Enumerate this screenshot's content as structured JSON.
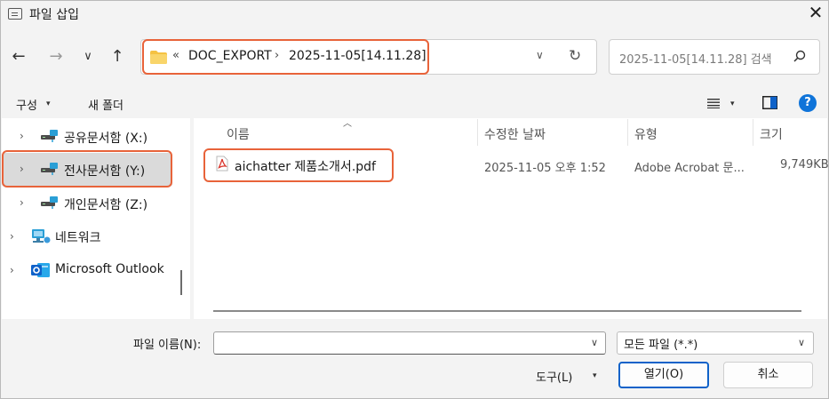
{
  "window": {
    "title": "파일 삽입"
  },
  "nav": {
    "back": "←",
    "forward": "→",
    "recent": "∨",
    "up": "↑"
  },
  "address": {
    "prefix": "«",
    "crumbs": [
      "DOC_EXPORT",
      "2025-11-05[14.11.28]"
    ],
    "separator": "›"
  },
  "search": {
    "placeholder": "2025-11-05[14.11.28] 검색"
  },
  "toolbar": {
    "organize": "구성",
    "new_folder": "새 폴더",
    "caret": "▾"
  },
  "tree": [
    {
      "label": "공유문서함 (X:)",
      "icon": "network-drive-icon"
    },
    {
      "label": "전사문서함 (Y:)",
      "icon": "network-drive-icon",
      "selected": true
    },
    {
      "label": "개인문서함 (Z:)",
      "icon": "network-drive-icon"
    },
    {
      "label": "네트워크",
      "icon": "network-icon"
    },
    {
      "label": "Microsoft Outlook",
      "icon": "outlook-icon"
    }
  ],
  "columns": {
    "name": "이름",
    "modified": "수정한 날짜",
    "type": "유형",
    "size": "크기"
  },
  "files": [
    {
      "name": "aichatter 제품소개서.pdf",
      "modified": "2025-11-05 오후 1:52",
      "type": "Adobe Acrobat 문...",
      "size": "9,749KB",
      "icon": "pdf-icon"
    }
  ],
  "footer": {
    "filename_label": "파일 이름(N):",
    "filename_value": "",
    "filter": "모든 파일 (*.*)",
    "tools": "도구(L)",
    "open": "열기(O)",
    "cancel": "취소"
  },
  "colors": {
    "highlight": "#e8633a",
    "accent": "#0f62c9",
    "folder": "#f5c242",
    "pdf": "#d9342b"
  }
}
